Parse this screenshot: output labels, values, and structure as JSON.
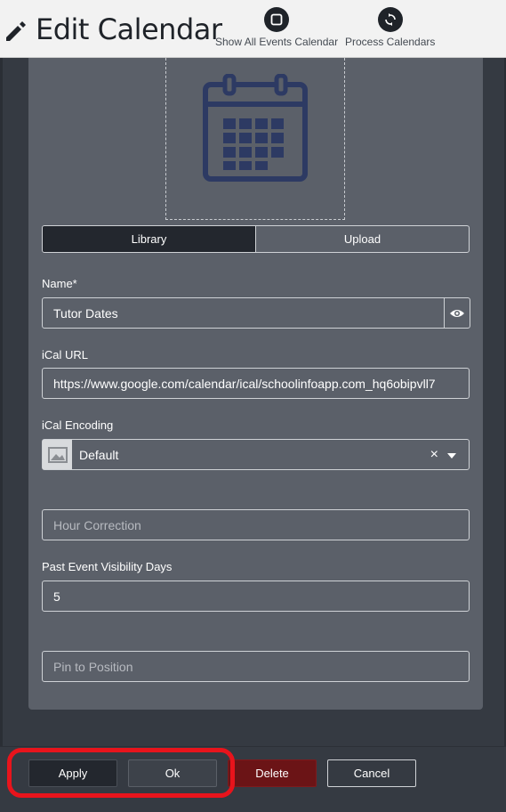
{
  "header": {
    "title": "Edit Calendar",
    "actions": [
      {
        "label": "Show All Events Calendar",
        "icon": "square-icon"
      },
      {
        "label": "Process Calendars",
        "icon": "refresh-icon"
      }
    ]
  },
  "image_source": {
    "tabs": [
      {
        "label": "Library",
        "active": true
      },
      {
        "label": "Upload",
        "active": false
      }
    ]
  },
  "form": {
    "name": {
      "label": "Name*",
      "value": "Tutor Dates"
    },
    "ical_url": {
      "label": "iCal URL",
      "value": "https://www.google.com/calendar/ical/schoolinfoapp.com_hq6obipvll7"
    },
    "ical_encoding": {
      "label": "iCal Encoding",
      "value": "Default",
      "clear": "×"
    },
    "hour_correction": {
      "placeholder": "Hour Correction"
    },
    "past_event_visibility": {
      "label": "Past Event Visibility Days",
      "value": "5"
    },
    "pin_to_position": {
      "placeholder": "Pin to Position"
    }
  },
  "footer": {
    "apply": "Apply",
    "ok": "Ok",
    "delete": "Delete",
    "cancel": "Cancel"
  },
  "colors": {
    "accent_dark": "#23272e",
    "delete": "#6b1416",
    "highlight": "#e8141c",
    "calendar_icon": "#2d3a63"
  }
}
